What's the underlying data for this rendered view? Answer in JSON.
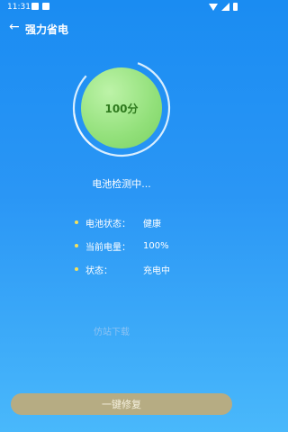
{
  "status_bar": {
    "time": "11:31"
  },
  "header": {
    "back_icon": "arrow-left-icon",
    "title": "强力省电"
  },
  "score": {
    "value": "100分",
    "ring_color": "#d9eefe",
    "fill_color": "#92e07a",
    "text_color": "#2f7a1e"
  },
  "checking_text": "电池检测中...",
  "info_rows": [
    {
      "label": "电池状态：",
      "value": "健康"
    },
    {
      "label": "当前电量：",
      "value": "100%"
    },
    {
      "label": "状态：",
      "value": "充电中"
    }
  ],
  "watermark": "仿站下载",
  "action_button": {
    "label": "一键修复",
    "color": "#b6ac83"
  }
}
